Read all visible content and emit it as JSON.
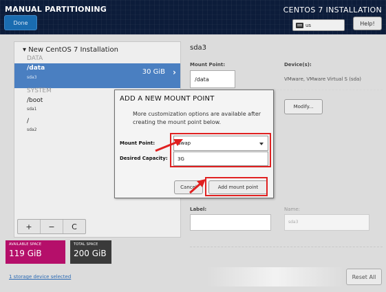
{
  "header": {
    "section_title": "MANUAL PARTITIONING",
    "done_label": "Done",
    "app_title": "CENTOS 7 INSTALLATION",
    "keyboard_layout": "us",
    "help_label": "Help!"
  },
  "left_panel": {
    "tree_title": "▾ New CentOS 7 Installation",
    "data_section": "DATA",
    "data_item": {
      "mount": "/data",
      "device": "sda3",
      "size": "30 GiB"
    },
    "system_section": "SYSTEM",
    "system_items": [
      {
        "mount": "/boot",
        "device": "sda1"
      },
      {
        "mount": "/",
        "device": "sda2"
      }
    ],
    "add_symbol": "+",
    "remove_symbol": "−",
    "refresh_symbol": "C"
  },
  "space": {
    "available_label": "AVAILABLE SPACE",
    "available_value": "119 GiB",
    "total_label": "TOTAL SPACE",
    "total_value": "200 GiB"
  },
  "storage_link": "1 storage device selected",
  "right_panel": {
    "title": "sda3",
    "mount_point_label": "Mount Point:",
    "mount_point_value": "/data",
    "device_label": "Device(s):",
    "device_value": "VMware, VMware Virtual S (sda)",
    "modify_label": "Modify...",
    "label_label": "Label:",
    "name_label": "Name:",
    "name_value": "sda3",
    "reset_label": "Reset All"
  },
  "dialog": {
    "title": "ADD A NEW MOUNT POINT",
    "description": "More customization options are available after creating the mount point below.",
    "mount_point_label": "Mount Point:",
    "mount_point_value": "swap",
    "capacity_label": "Desired Capacity:",
    "capacity_value": "3G",
    "cancel_label": "Cancel",
    "add_label": "Add mount point"
  },
  "colors": {
    "header_bg": "#0c1c3a",
    "selected_row": "#4a7fc1",
    "available_space": "#b50f6a",
    "total_space": "#3a3a3a",
    "annotation_red": "#e02020"
  }
}
